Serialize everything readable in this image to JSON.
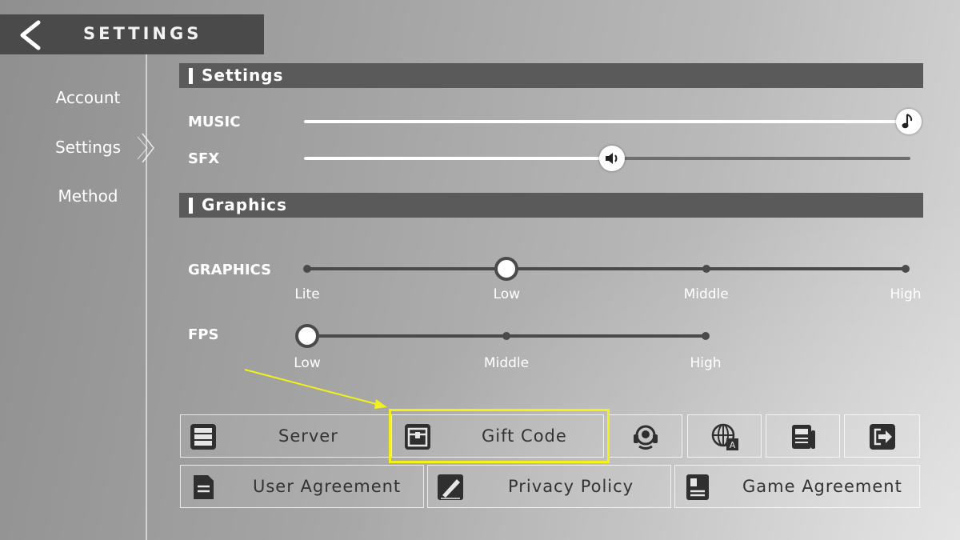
{
  "header": {
    "title": "SETTINGS"
  },
  "nav": {
    "items": [
      {
        "label": "Account"
      },
      {
        "label": "Settings"
      },
      {
        "label": "Method"
      }
    ],
    "active": "Settings"
  },
  "sections": {
    "audio_title": "Settings",
    "graphics_title": "Graphics"
  },
  "audio": {
    "music": {
      "label": "MUSIC",
      "level": 1.0
    },
    "sfx": {
      "label": "SFX",
      "level": 0.5
    }
  },
  "graphics": {
    "label": "GRAPHICS",
    "options": [
      "Lite",
      "Low",
      "Middle",
      "High"
    ],
    "selected": "Low"
  },
  "fps": {
    "label": "FPS",
    "options": [
      "Low",
      "Middle",
      "High"
    ],
    "selected": "Low"
  },
  "buttons": {
    "server": "Server",
    "gift_code": "Gift Code",
    "user_agreement": "User Agreement",
    "privacy_policy": "Privacy Policy",
    "game_agreement": "Game Agreement"
  },
  "icons": {
    "back": "chevron-left-icon",
    "server": "server-icon",
    "gift_code": "gift-icon",
    "support": "headset-icon",
    "language": "language-icon",
    "news": "newspaper-icon",
    "logout": "logout-icon",
    "user_agreement": "document-icon",
    "privacy_policy": "signature-icon",
    "game_agreement": "agreement-book-icon"
  },
  "colors": {
    "highlight": "#f2f21a",
    "panel": "#5a5a5a",
    "header": "#4a4a4a"
  }
}
